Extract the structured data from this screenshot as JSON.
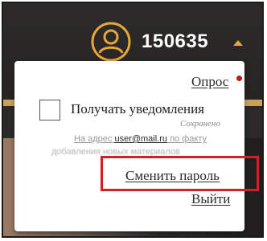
{
  "header": {
    "user_id": "150635",
    "accent": "#e7a53a"
  },
  "dropdown": {
    "poll_label": "Опрос",
    "notify_label": "Получать уведомления",
    "notify_checked": false,
    "saved_label": "Сохранено",
    "email_prefix": "На адрес ",
    "email": "user@mail.ru",
    "email_suffix": " по факту",
    "blurred_line": "добавления новых материалов",
    "change_password_label": "Сменить пароль",
    "logout_label": "Выйти"
  },
  "colors": {
    "highlight": "#d31f25",
    "notification_dot": "#b51f1f"
  }
}
